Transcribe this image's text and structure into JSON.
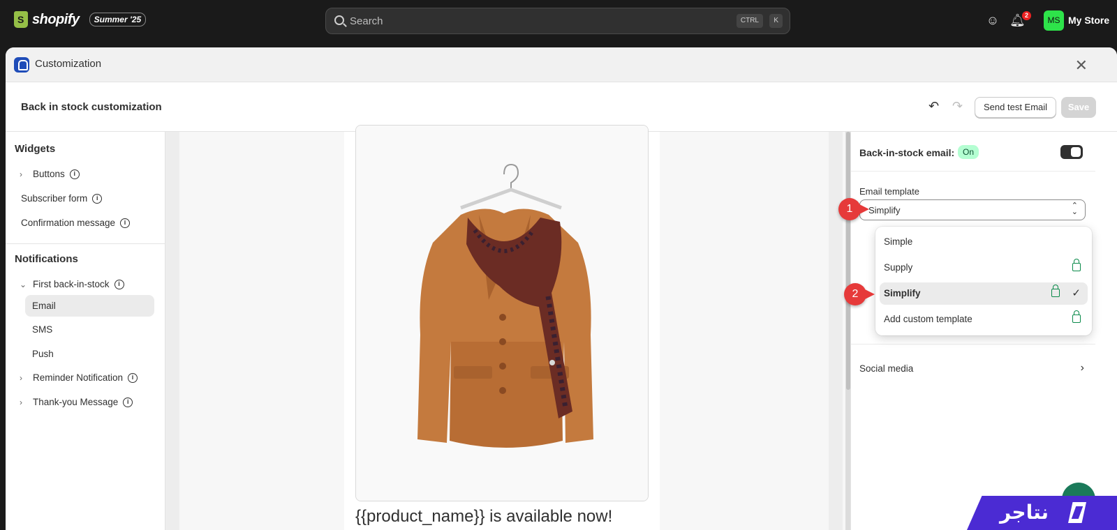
{
  "topbar": {
    "brand": "shopify",
    "edition": "Summer '25",
    "search_placeholder": "Search",
    "shortcut_ctrl": "CTRL",
    "shortcut_k": "K",
    "notification_count": "2",
    "avatar_initials": "MS",
    "store_name": "My Store"
  },
  "modal": {
    "title": "Customization",
    "page_title": "Back in stock customization",
    "send_test_label": "Send test Email",
    "save_label": "Save"
  },
  "sidebar": {
    "widgets_title": "Widgets",
    "widgets": [
      {
        "label": "Buttons"
      },
      {
        "label": "Subscriber form"
      },
      {
        "label": "Confirmation message"
      }
    ],
    "notifications_title": "Notifications",
    "notifications": [
      {
        "label": "First back-in-stock"
      },
      {
        "label": "Email"
      },
      {
        "label": "SMS"
      },
      {
        "label": "Push"
      },
      {
        "label": "Reminder Notification"
      },
      {
        "label": "Thank-you Message"
      }
    ]
  },
  "preview": {
    "caption": "{{product_name}} is available now!"
  },
  "settings": {
    "email_toggle_label": "Back-in-stock email:",
    "email_status": "On",
    "template_label": "Email template",
    "template_value": "Simplify",
    "social_media_label": "Social media"
  },
  "dropdown": {
    "options": [
      {
        "label": "Simple",
        "locked": false,
        "selected": false
      },
      {
        "label": "Supply",
        "locked": true,
        "selected": false
      },
      {
        "label": "Simplify",
        "locked": true,
        "selected": true
      },
      {
        "label": "Add custom template",
        "locked": true,
        "selected": false
      }
    ]
  },
  "callouts": [
    "1",
    "2"
  ],
  "watermark": {
    "text": "نتاجر"
  },
  "colors": {
    "accent_green": "#0a8a4a",
    "badge_on_bg": "#b4fed2",
    "callout_red": "#e63a3a",
    "brand_purple": "#4b2bd3"
  }
}
